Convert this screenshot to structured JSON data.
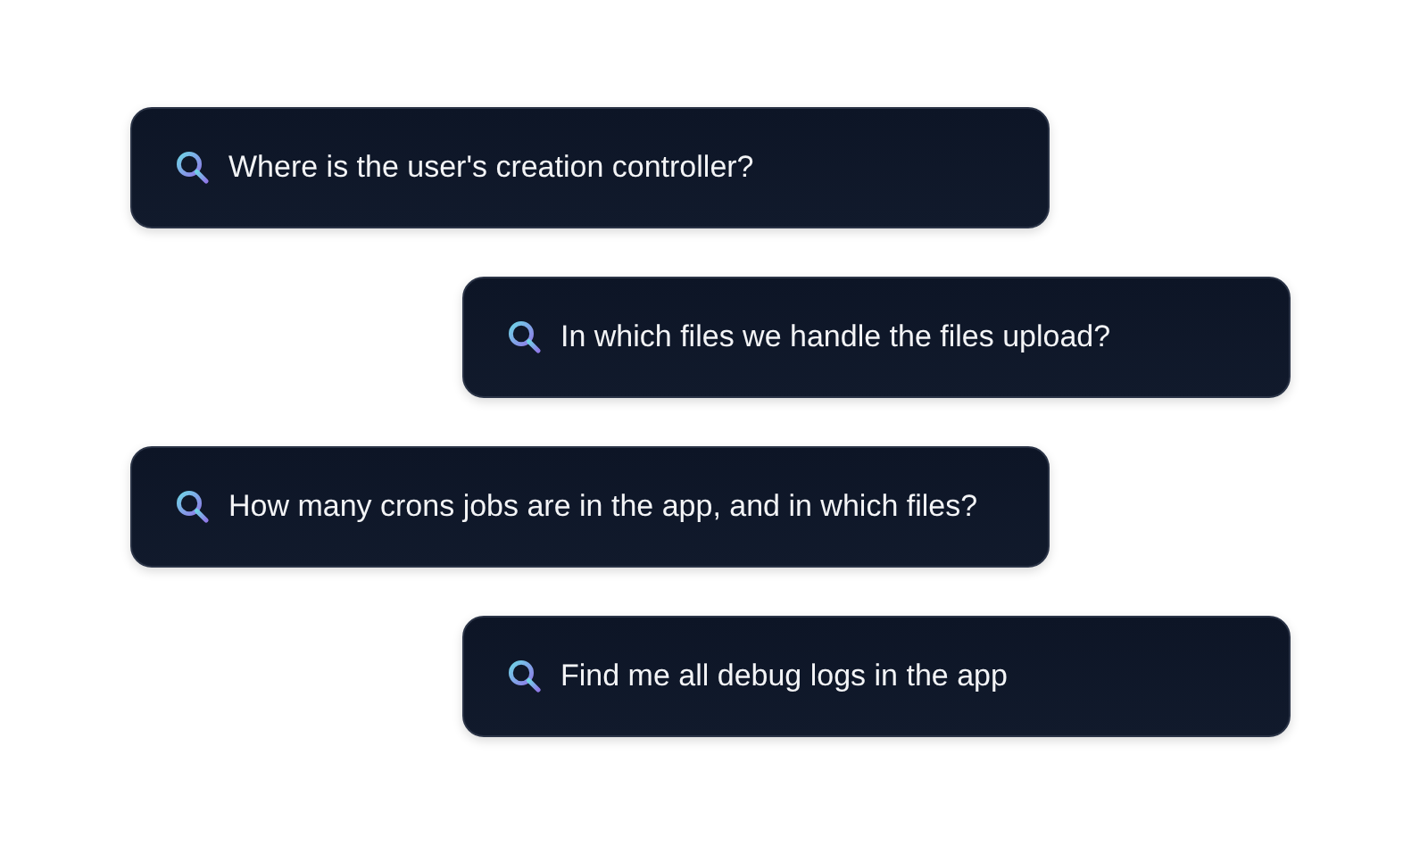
{
  "queries": [
    {
      "text": "Where is the user's creation controller?"
    },
    {
      "text": "In which files we handle the files upload?"
    },
    {
      "text": "How many crons jobs are in the app, and in which files?"
    },
    {
      "text": "Find me all debug logs in the app"
    }
  ]
}
